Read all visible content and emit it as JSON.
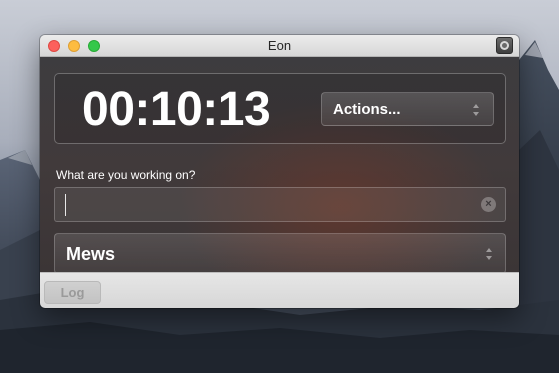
{
  "window": {
    "title": "Eon"
  },
  "timer": {
    "value": "00:10:13"
  },
  "actions": {
    "label": "Actions..."
  },
  "task": {
    "prompt": "What are you working on?",
    "value": "",
    "placeholder": ""
  },
  "project": {
    "selected": "Mews"
  },
  "footer": {
    "log_label": "Log"
  },
  "icons": {
    "clear": "clear-icon",
    "window_extra": "record-icon",
    "popup_arrows": "updown-chevrons-icon"
  },
  "colors": {
    "close": "#fc605c",
    "minimize": "#fdbc40",
    "zoom": "#34c84a",
    "panel": "#3d3c3f",
    "accent_glow": "#783726"
  }
}
